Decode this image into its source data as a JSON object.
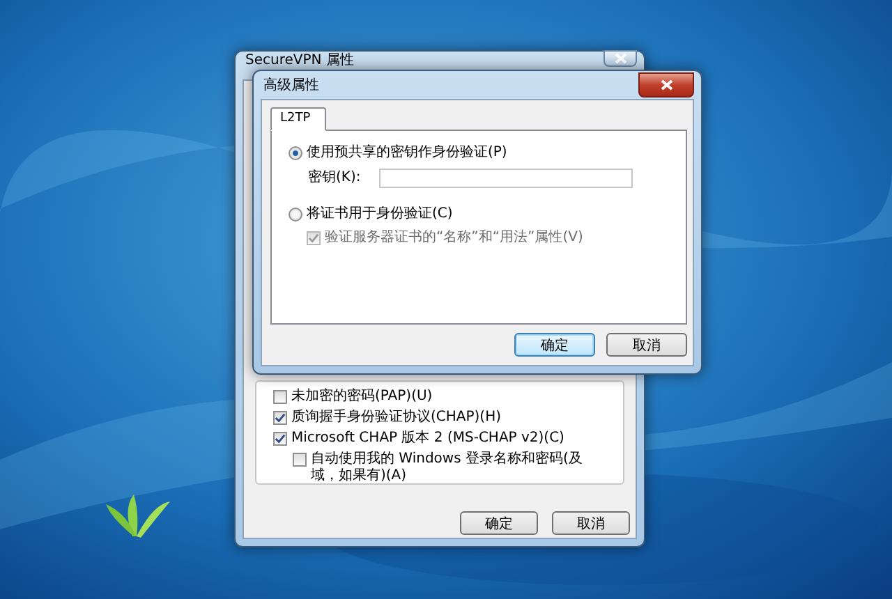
{
  "background_window": {
    "title": "SecureVPN 属性",
    "auth_options": [
      {
        "label": "未加密的密码(PAP)(U)",
        "checked": false
      },
      {
        "label": "质询握手身份验证协议(CHAP)(H)",
        "checked": true
      },
      {
        "label": "Microsoft CHAP 版本 2 (MS-CHAP v2)(C)",
        "checked": true,
        "children": [
          {
            "label": "自动使用我的 Windows 登录名称和密码(及域，如果有)(A)",
            "checked": false
          }
        ]
      }
    ],
    "buttons": [
      {
        "label": "确定"
      },
      {
        "label": "取消"
      }
    ]
  },
  "dialog": {
    "title": "高级属性",
    "tabs": [
      {
        "label": "L2TP",
        "selected": true
      }
    ],
    "options": [
      {
        "label": "使用预共享的密钥作身份验证(P)",
        "selected": true,
        "field": {
          "label": "密钥(K):"
        }
      },
      {
        "label": "将证书用于身份验证(C)",
        "selected": false,
        "children": [
          {
            "label": "验证服务器证书的“名称”和“用法”属性(V)",
            "checked": true,
            "disabled": true
          }
        ]
      }
    ],
    "buttons": [
      {
        "label": "确定",
        "default": true
      },
      {
        "label": "取消",
        "default": false
      }
    ]
  }
}
